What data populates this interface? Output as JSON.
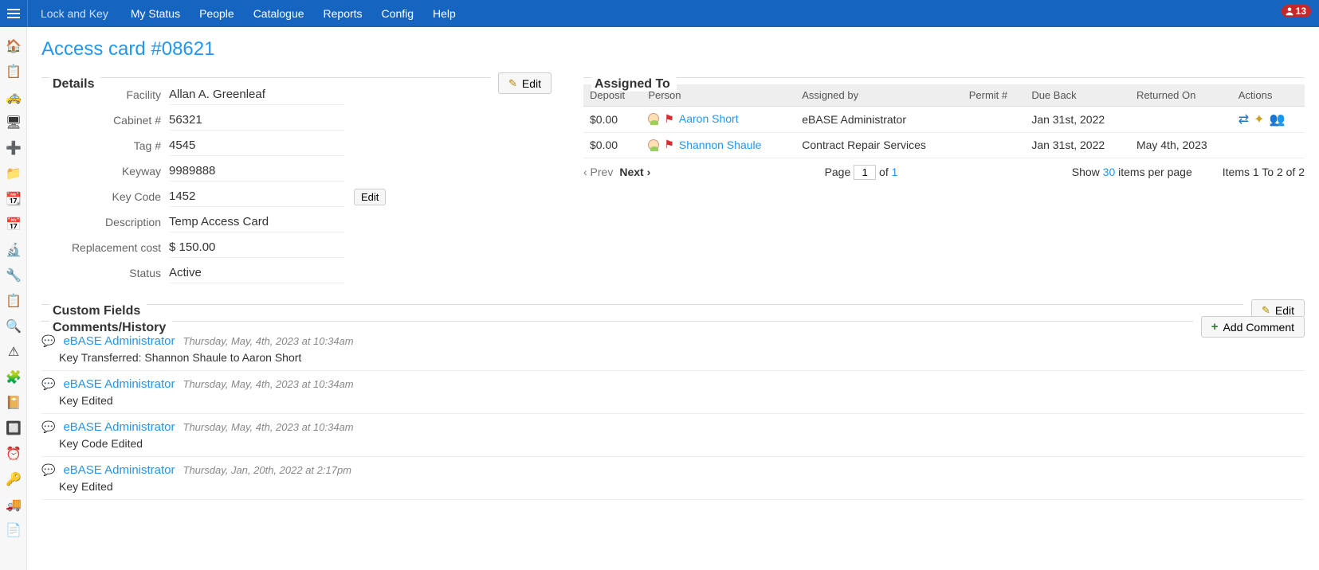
{
  "topbar": {
    "brand": "Lock and Key",
    "nav": [
      "My Status",
      "People",
      "Catalogue",
      "Reports",
      "Config",
      "Help"
    ],
    "notif_count": "13"
  },
  "page_title": "Access card #08621",
  "details_section_title": "Details",
  "details_edit_label": "Edit",
  "details": [
    {
      "label": "Facility",
      "value": "Allan A. Greenleaf"
    },
    {
      "label": "Cabinet #",
      "value": "56321"
    },
    {
      "label": "Tag #",
      "value": "4545"
    },
    {
      "label": "Keyway",
      "value": "9989888"
    },
    {
      "label": "Key Code",
      "value": "1452",
      "edit": true
    },
    {
      "label": "Description",
      "value": "Temp Access Card"
    },
    {
      "label": "Replacement cost",
      "value": "$ 150.00"
    },
    {
      "label": "Status",
      "value": "Active"
    }
  ],
  "keycode_edit_label": "Edit",
  "custom_fields_title": "Custom Fields",
  "custom_fields_edit_label": "Edit",
  "comments_title": "Comments/History",
  "add_comment_label": "Add Comment",
  "assigned_title": "Assigned To",
  "assigned_headers": [
    "Deposit",
    "Person",
    "Assigned by",
    "Permit #",
    "Due Back",
    "Returned On",
    "Actions"
  ],
  "assigned_rows": [
    {
      "deposit": "$0.00",
      "person": "Aaron Short",
      "assigned_by": "eBASE Administrator",
      "permit": "",
      "due_back": "Jan 31st, 2022",
      "returned": "",
      "has_actions": true
    },
    {
      "deposit": "$0.00",
      "person": "Shannon Shaule",
      "assigned_by": "Contract Repair Services",
      "permit": "",
      "due_back": "Jan 31st, 2022",
      "returned": "May 4th, 2023",
      "has_actions": false
    }
  ],
  "pager": {
    "prev": "‹ Prev",
    "next": "Next ›",
    "page_label": "Page",
    "page_value": "1",
    "of_label": "of",
    "total_pages": "1",
    "show_prefix": "Show",
    "per_page": "30",
    "show_suffix": "items per page",
    "range": "Items 1 To 2 of 2"
  },
  "comments": [
    {
      "who": "eBASE Administrator",
      "when": "Thursday, May, 4th, 2023 at 10:34am",
      "body": "Key Transferred: Shannon Shaule to Aaron Short"
    },
    {
      "who": "eBASE Administrator",
      "when": "Thursday, May, 4th, 2023 at 10:34am",
      "body": "Key Edited"
    },
    {
      "who": "eBASE Administrator",
      "when": "Thursday, May, 4th, 2023 at 10:34am",
      "body": "Key Code Edited"
    },
    {
      "who": "eBASE Administrator",
      "when": "Thursday, Jan, 20th, 2022 at 2:17pm",
      "body": "Key Edited"
    }
  ],
  "sidebar_icons": [
    "🏠",
    "📋",
    "🚕",
    "🖥",
    "➕",
    "📁",
    "📆",
    "📅",
    "🔬",
    "🔧",
    "📋",
    "🔍",
    "⚠",
    "🧩",
    "📔",
    "🔲",
    "⏰",
    "🔑",
    "🚚",
    "📄"
  ]
}
